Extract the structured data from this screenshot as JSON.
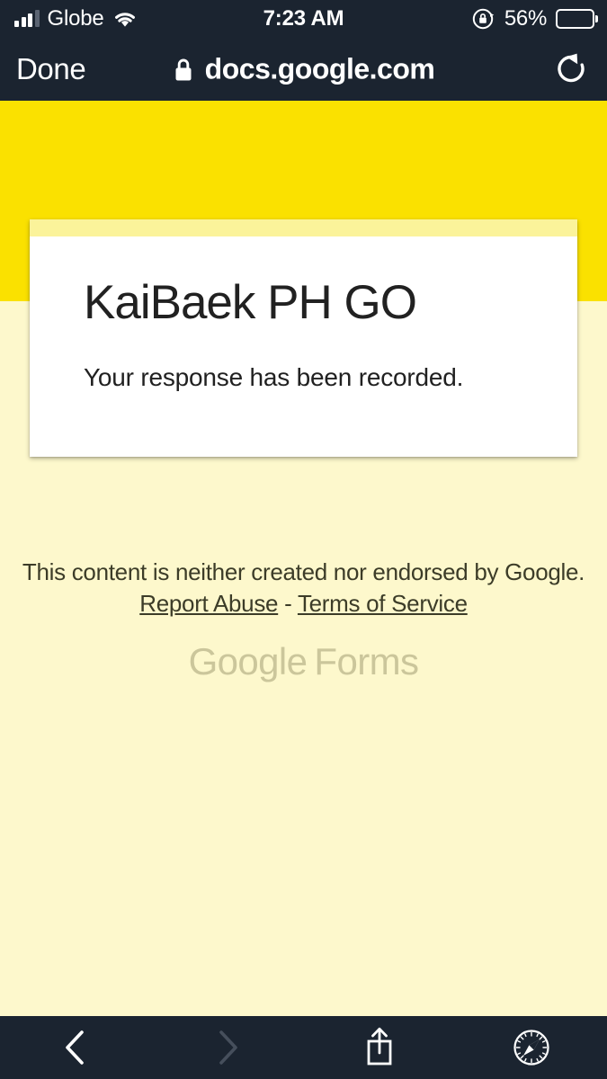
{
  "status_bar": {
    "carrier": "Globe",
    "signal_icon": "signal-bars-icon",
    "wifi_icon": "wifi-icon",
    "time": "7:23 AM",
    "rotation_lock_icon": "rotation-lock-icon",
    "battery_percent": "56%",
    "battery_level": 56,
    "battery_icon": "battery-icon"
  },
  "nav_bar": {
    "done_label": "Done",
    "lock_icon": "lock-icon",
    "url": "docs.google.com",
    "reload_icon": "reload-icon"
  },
  "page": {
    "theme": {
      "header_yellow": "#FAE100",
      "body_yellow": "#FDF8CC",
      "card_strip": "#FBF39A",
      "card_white": "#FFFFFF"
    },
    "card": {
      "title": "KaiBaek PH GO",
      "subtitle": "Your response has been recorded."
    },
    "footer": {
      "disclaimer": "This content is neither created nor endorsed by Google.",
      "report_abuse": "Report Abuse",
      "separator": " - ",
      "terms_of_service": "Terms of Service"
    },
    "logo": {
      "google": "Google",
      "forms": "Forms"
    }
  },
  "toolbar": {
    "back_icon": "chevron-left-icon",
    "forward_icon": "chevron-right-icon",
    "share_icon": "share-icon",
    "tabs_icon": "safari-compass-icon"
  }
}
